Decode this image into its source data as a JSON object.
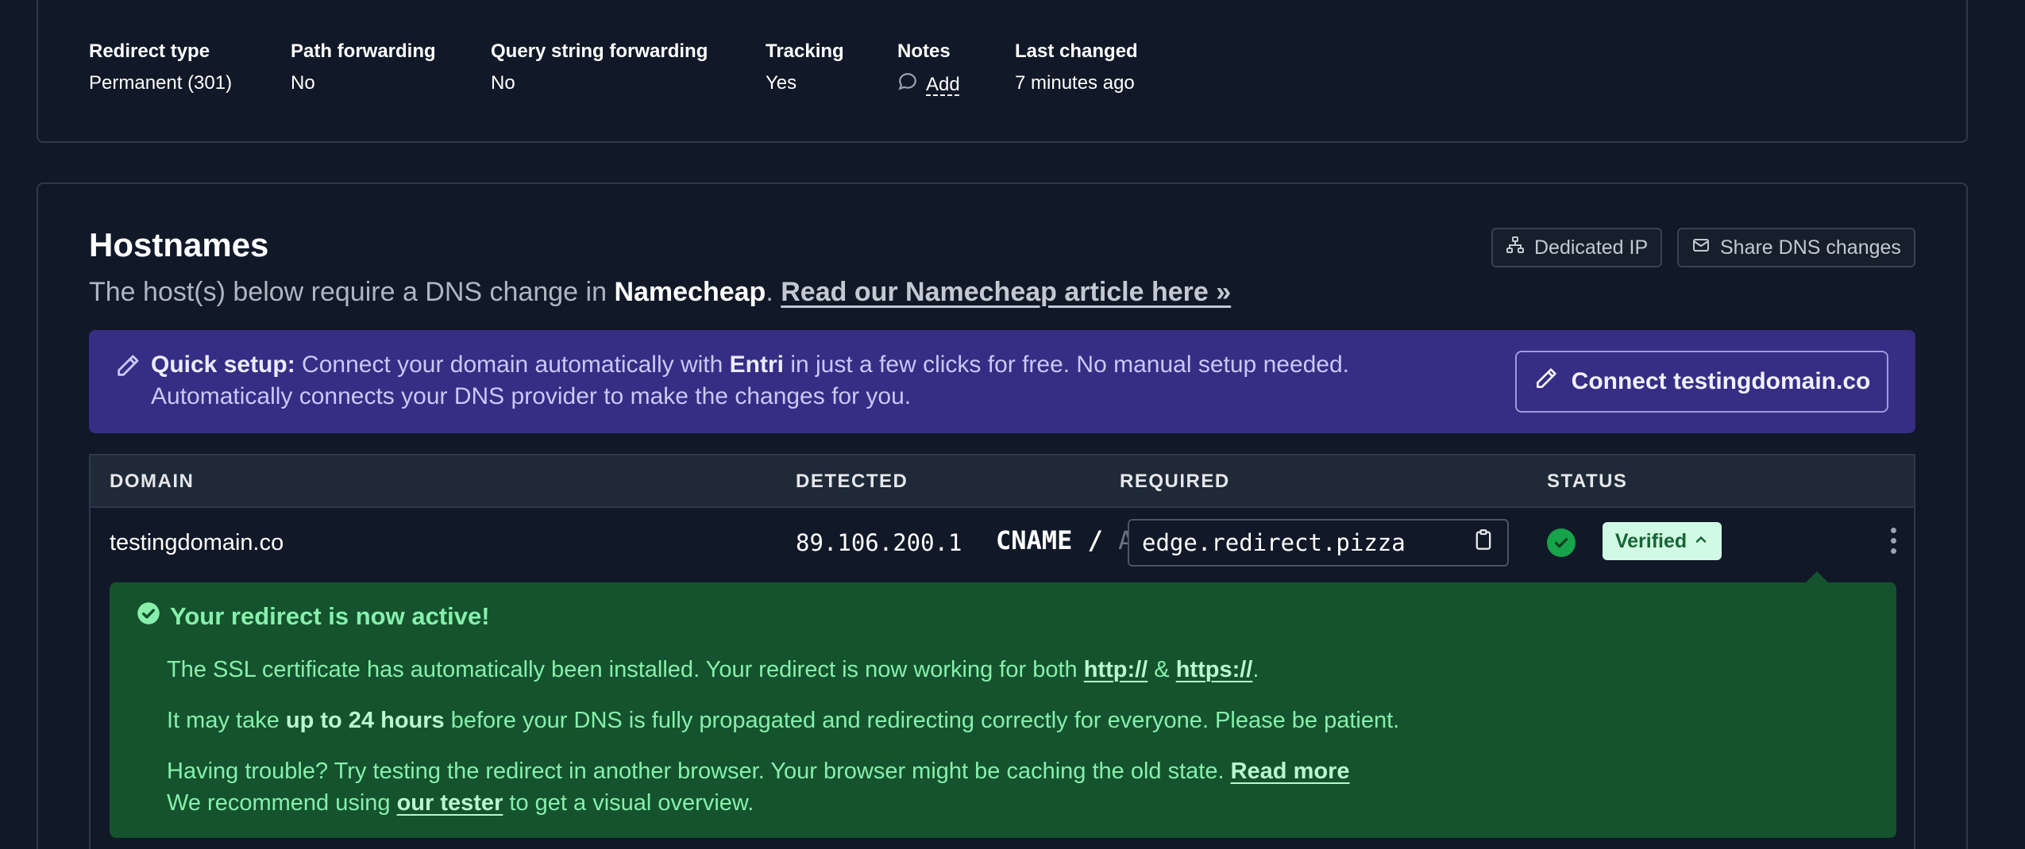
{
  "settings": {
    "redirect_type": {
      "label": "Redirect type",
      "value": "Permanent (301)"
    },
    "path_forwarding": {
      "label": "Path forwarding",
      "value": "No"
    },
    "query_forwarding": {
      "label": "Query string forwarding",
      "value": "No"
    },
    "tracking": {
      "label": "Tracking",
      "value": "Yes"
    },
    "notes": {
      "label": "Notes",
      "action": "Add",
      "icon": "comment-icon"
    },
    "last_changed": {
      "label": "Last changed",
      "value": "7 minutes ago"
    }
  },
  "hostnames": {
    "title": "Hostnames",
    "subtitle_prefix": "The host(s) below require a DNS change in ",
    "provider": "Namecheap",
    "subtitle_sep": ". ",
    "article_link": "Read our Namecheap article here »",
    "dedicated_ip_label": "Dedicated IP",
    "share_dns_label": "Share DNS changes"
  },
  "quick_setup": {
    "label": "Quick setup:",
    "text_1": " Connect your domain automatically with ",
    "provider": "Entri",
    "text_2": " in just a few clicks for free. No manual setup needed.",
    "line_2": "Automatically connects your DNS provider to make the changes for you.",
    "connect_label": "Connect testingdomain.co",
    "colors": {
      "background": "#362d84",
      "text": "#c9c8f8"
    }
  },
  "table": {
    "headers": {
      "domain": "DOMAIN",
      "detected": "DETECTED",
      "required": "REQUIRED",
      "status": "STATUS"
    },
    "row": {
      "domain": "testingdomain.co",
      "detected": "89.106.200.1",
      "record_type": "CNAME",
      "record_sep": " / ",
      "record_alt": "A",
      "required_value": "edge.redirect.pizza",
      "status": "Verified"
    }
  },
  "success": {
    "title": "Your redirect is now active!",
    "line1_prefix": "The SSL certificate has automatically been installed. Your redirect is now working for both ",
    "http_link": "http://",
    "amp": " & ",
    "https_link": "https://",
    "line1_end": ".",
    "line2_prefix": "It may take ",
    "line2_bold": "up to 24 hours",
    "line2_suffix": " before your DNS is fully propagated and redirecting correctly for everyone. Please be patient.",
    "line3_prefix": "Having trouble? Try testing the redirect in another browser. Your browser might be caching the old state. ",
    "read_more": "Read more",
    "line4_prefix": "We recommend using ",
    "tester_link": "our tester",
    "line4_suffix": " to get a visual overview.",
    "colors": {
      "background": "#14532d",
      "text": "#86efac"
    }
  }
}
